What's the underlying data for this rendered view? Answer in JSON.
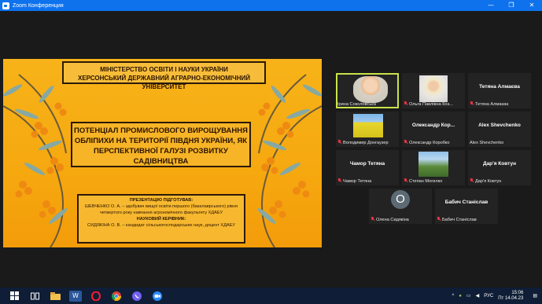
{
  "window": {
    "title": "Zoom Конференция",
    "minimize": "—",
    "maximize": "❐",
    "close": "✕"
  },
  "slide": {
    "ministry_line1": "МІНІСТЕРСТВО ОСВІТИ І НАУКИ УКРАЇНИ",
    "ministry_line2": "ХЕРСОНСЬКИЙ ДЕРЖАВНИЙ АГРАРНО-ЕКОНОМІЧНИЙ УНІВЕРСИТЕТ",
    "title": "ПОТЕНЦІАЛ ПРОМИСЛОВОГО ВИРОЩУВАННЯ ОБЛІПИХИ НА ТЕРИТОРІЇ ПІВДНЯ УКРАЇНИ, ЯК ПЕРСПЕКТИВНОЇ ГАЛУЗІ РОЗВИТКУ САДІВНИЦТВА",
    "prepared_heading": "ПРЕЗЕНТАЦІЮ ПІДГОТУВАВ:",
    "prepared_by": "ШЕВЧЕНКО О. А. – здобувач вищої освіти першого (бакалаврського) рівня четвертого року навчання агрономічного факультету ХДАЕУ",
    "supervisor_heading": "НАУКОВИЙ КЕРІВНИК:",
    "supervisor": "СИДЯКІНА О. В. – кандидат сільськогосподарських наук, доцент ХДАЕУ"
  },
  "participants": [
    {
      "name": "Ірина Соколовська",
      "display": "",
      "muted": false,
      "media": "video"
    },
    {
      "name": "Ольга Павлівна Коз...",
      "display": "",
      "muted": true,
      "media": "photo-olga"
    },
    {
      "name": "Тетяна Алмаєва",
      "display": "Тетяна Алмаєва",
      "muted": true,
      "media": "name"
    },
    {
      "name": "Володимир Донгаузер",
      "display": "",
      "muted": true,
      "media": "photo-vol"
    },
    {
      "name": "Олександр Коробко",
      "display": "Олександр  Кор...",
      "muted": true,
      "media": "name"
    },
    {
      "name": "Alex Shevchenko",
      "display": "Alex Shevchenko",
      "muted": false,
      "media": "name"
    },
    {
      "name": "Чамор Тетяна",
      "display": "Чамор Тетяна",
      "muted": true,
      "media": "name"
    },
    {
      "name": "Степан Могилко",
      "display": "",
      "muted": true,
      "media": "photo-stepan"
    },
    {
      "name": "Дар'я Ковтун",
      "display": "Дар'я Ковтун",
      "muted": true,
      "media": "name"
    },
    {
      "name": "Олена Сидякіна",
      "display": "O",
      "muted": true,
      "media": "avatar"
    },
    {
      "name": "Бабич Станіслав",
      "display": "Бабич Станіслав",
      "muted": true,
      "media": "name"
    }
  ],
  "taskbar": {
    "lang": "РУС",
    "time": "15:06",
    "date": "Пт 14.04.23"
  }
}
